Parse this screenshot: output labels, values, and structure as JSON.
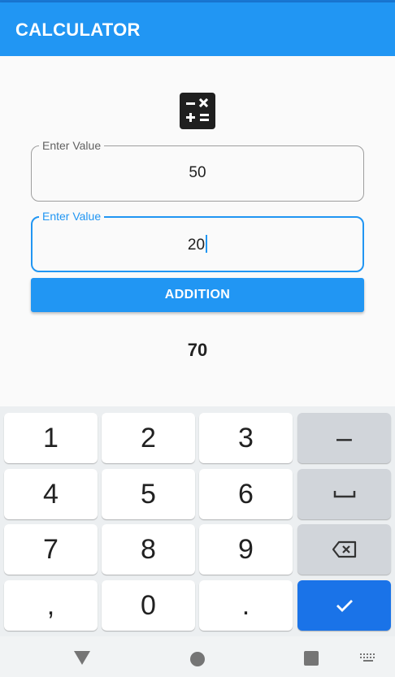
{
  "app": {
    "title": "CALCULATOR"
  },
  "icons": {
    "header": "calculator-icon",
    "back": "nav-back-icon",
    "home": "nav-home-icon",
    "recents": "nav-recents-icon",
    "keyboard": "keyboard-switch-icon"
  },
  "form": {
    "field1": {
      "label": "Enter Value",
      "value": "50"
    },
    "field2": {
      "label": "Enter Value",
      "value": "20"
    },
    "button_label": "ADDITION",
    "result": "70"
  },
  "keyboard": {
    "rows": [
      [
        "1",
        "2",
        "3",
        "–"
      ],
      [
        "4",
        "5",
        "6",
        "space"
      ],
      [
        "7",
        "8",
        "9",
        "backspace"
      ],
      [
        ",",
        "0",
        ".",
        "done"
      ]
    ]
  },
  "colors": {
    "primary": "#2196f3",
    "done_key": "#1a73e8"
  }
}
